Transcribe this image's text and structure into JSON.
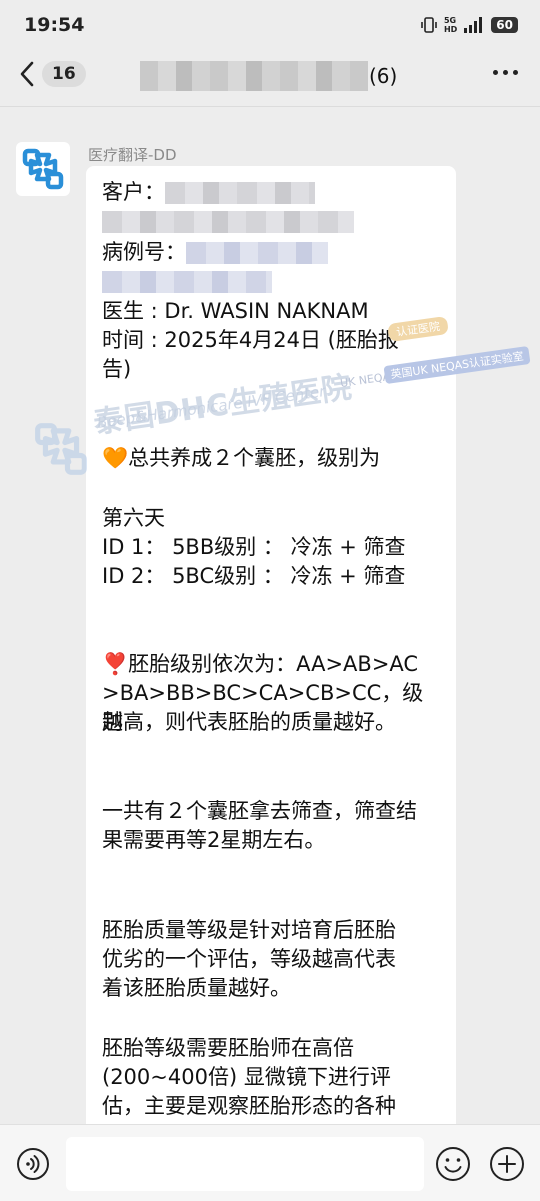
{
  "status_bar": {
    "time": "19:54",
    "net_top": "5G",
    "net_bottom": "HD",
    "battery": "60",
    "icons": [
      "vibrate-icon",
      "signal-icon",
      "battery-icon"
    ]
  },
  "nav": {
    "unread_count": "16",
    "group_member_count": "(6)",
    "icons": [
      "back-chevron-icon",
      "more-dots-icon"
    ]
  },
  "message": {
    "sender": "医疗翻译-DD",
    "customer_label": "客户：",
    "case_label": "病例号：",
    "doctor": "医生 : Dr. WASIN  NAKNAM",
    "time_line1": "时间 : 2025年4月24日 (胚胎报",
    "time_line2": "告)",
    "total_line": "🧡总共养成２个囊胚，级别为",
    "day6": "第六天",
    "id1": "ID 1： 5BB级别 ： 冷冻 + 筛查",
    "id2": "ID 2： 5BC级别 ： 冷冻 + 筛查",
    "grade_order_line1": "❣️胚胎级别依次为：AA>AB>AC",
    "grade_order_line2": ">BA>BB>BC>CA>CB>CC，级别",
    "grade_order_line3": "越高，则代表胚胎的质量越好。",
    "screening_line1": "一共有２个囊胚拿去筛查，筛查结",
    "screening_line2": "果需要再等2星期左右。",
    "quality_line1": "胚胎质量等级是针对培育后胚胎",
    "quality_line2": "优劣的一个评估，等级越高代表",
    "quality_line3": "着该胚胎质量越好。",
    "method_line1": "胚胎等级需要胚胎师在高倍",
    "method_line2": "(200~400倍) 显微镜下进行评",
    "method_line3": "估，主要是观察胚胎形态的各种"
  },
  "watermark": {
    "name": "泰国DHC生殖医院",
    "sub": "Beep&Harmonicare IVF Center",
    "cert1": "认证医院",
    "cert2": "英国UK NEQAS认证实验室",
    "uk": "UK NEQAS"
  },
  "input_bar": {
    "icons": [
      "voice-icon",
      "emoji-icon",
      "plus-icon"
    ]
  },
  "colors": {
    "background": "#ededed",
    "bubble": "#ffffff",
    "avatar_logo": "#2a8fd8"
  }
}
